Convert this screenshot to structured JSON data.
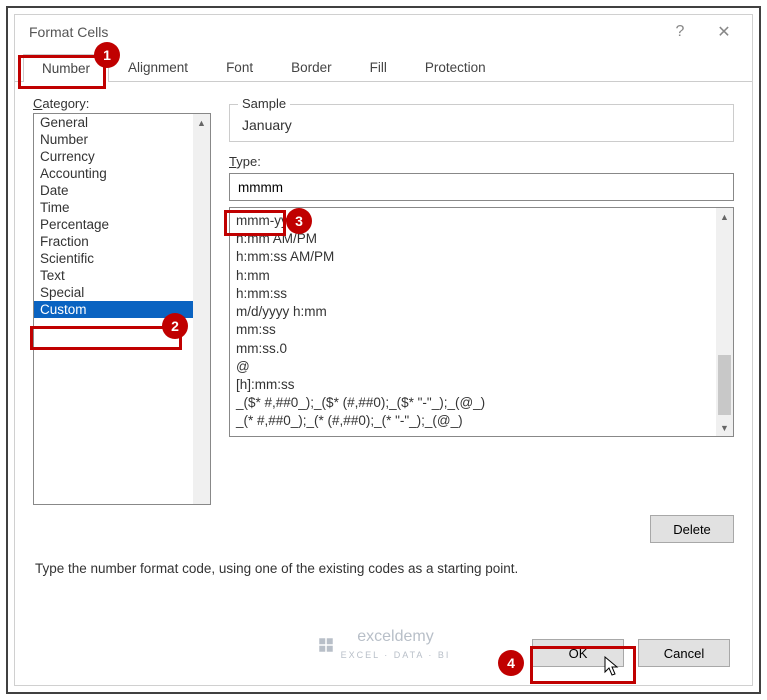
{
  "dialog": {
    "title": "Format Cells",
    "help_icon": "?",
    "close_icon": "✕"
  },
  "tabs": [
    {
      "label": "Number",
      "active": true
    },
    {
      "label": "Alignment",
      "active": false
    },
    {
      "label": "Font",
      "active": false
    },
    {
      "label": "Border",
      "active": false
    },
    {
      "label": "Fill",
      "active": false
    },
    {
      "label": "Protection",
      "active": false
    }
  ],
  "category": {
    "label": "Category:",
    "items": [
      "General",
      "Number",
      "Currency",
      "Accounting",
      "Date",
      "Time",
      "Percentage",
      "Fraction",
      "Scientific",
      "Text",
      "Special",
      "Custom"
    ],
    "selected": "Custom"
  },
  "sample": {
    "legend": "Sample",
    "value": "January"
  },
  "type": {
    "label": "Type:",
    "value": "mmmm",
    "list": [
      "mmm-yy",
      "h:mm AM/PM",
      "h:mm:ss AM/PM",
      "h:mm",
      "h:mm:ss",
      "m/d/yyyy h:mm",
      "mm:ss",
      "mm:ss.0",
      "@",
      "[h]:mm:ss",
      "_($* #,##0_);_($* (#,##0);_($* \"-\"_);_(@_)",
      "_(* #,##0_);_(* (#,##0);_(* \"-\"_);_(@_)"
    ]
  },
  "buttons": {
    "delete": "Delete",
    "ok": "OK",
    "cancel": "Cancel"
  },
  "helper_text": "Type the number format code, using one of the existing codes as a starting point.",
  "callouts": {
    "1": "1",
    "2": "2",
    "3": "3",
    "4": "4"
  },
  "watermark": {
    "brand": "exceldemy",
    "sub": "EXCEL · DATA · BI"
  }
}
